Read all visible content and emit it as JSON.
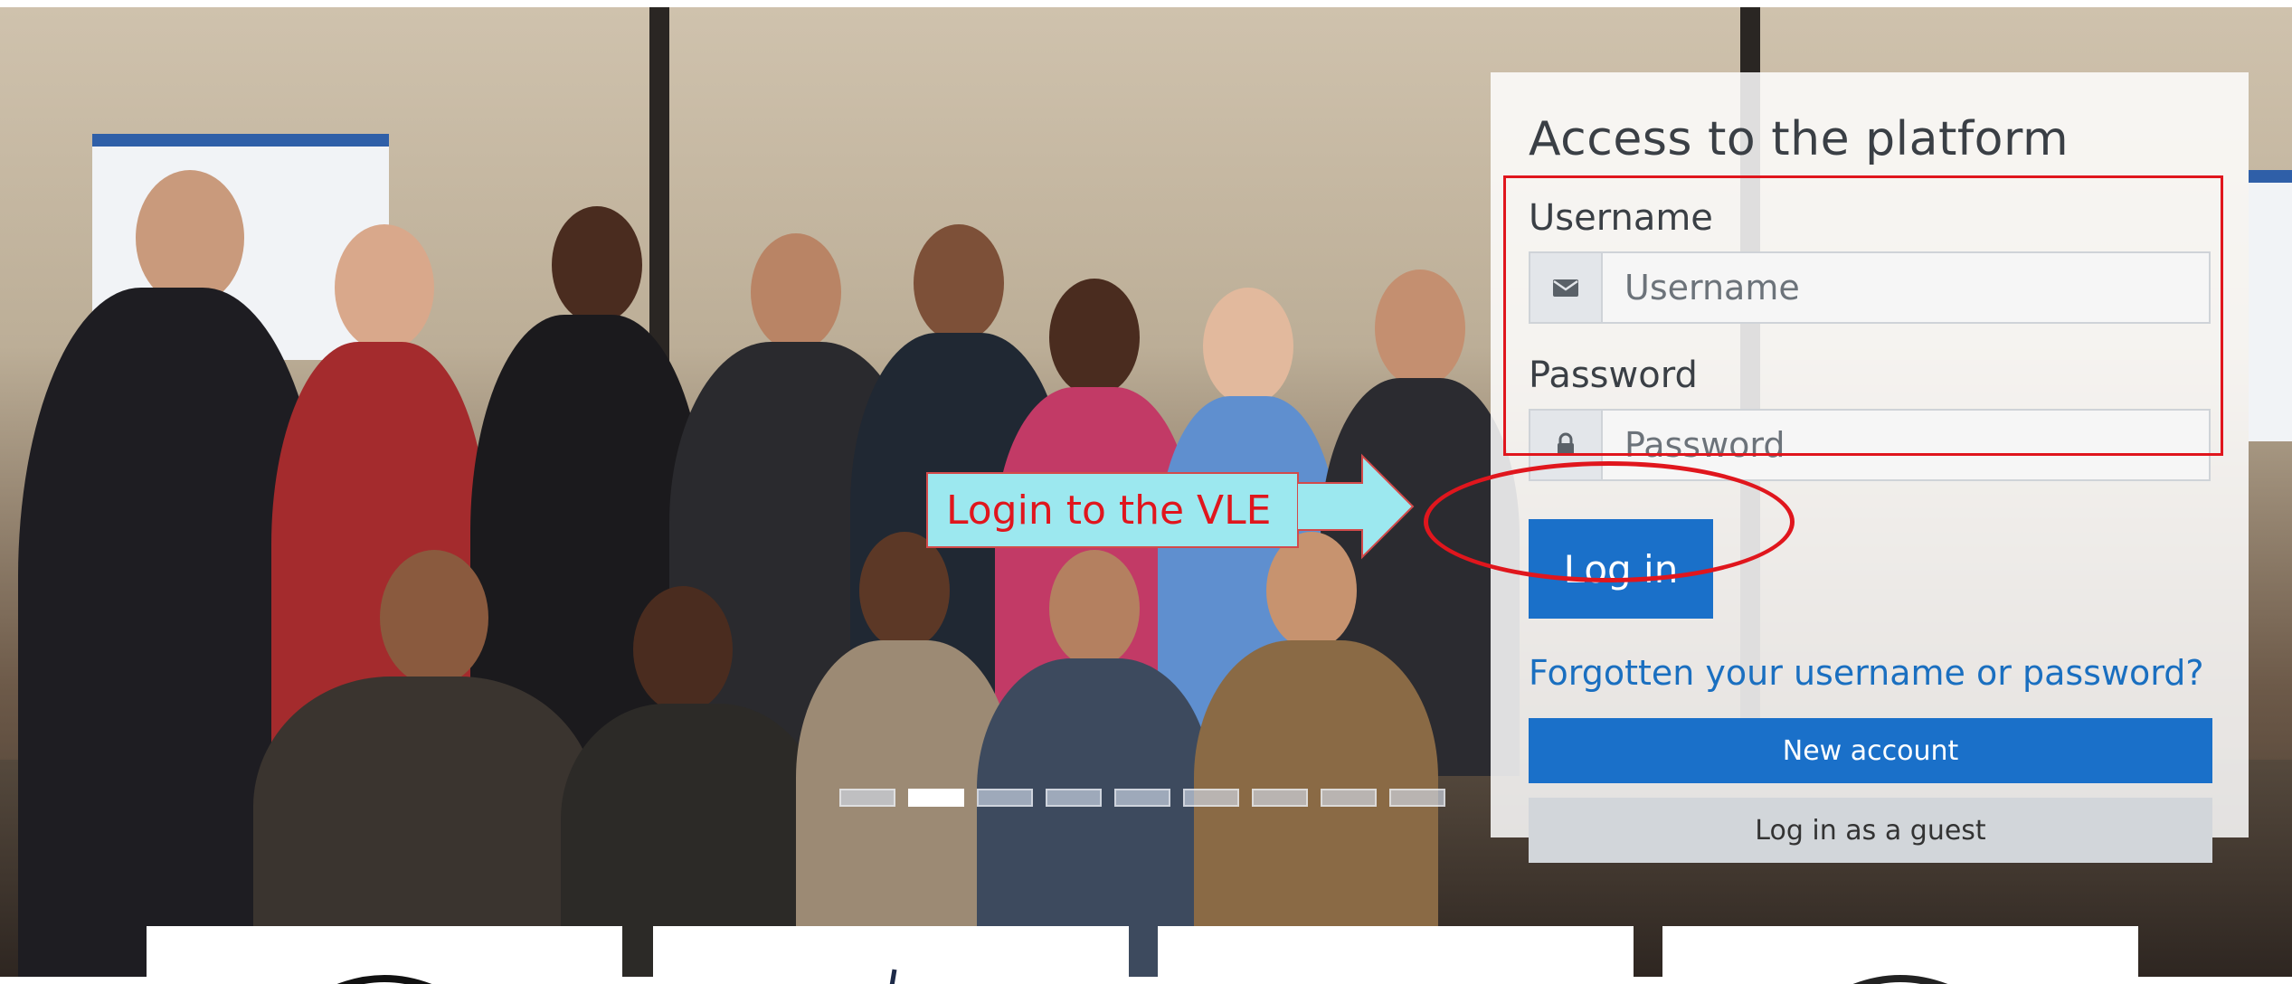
{
  "login": {
    "title": "Access to the platform",
    "username_label": "Username",
    "username_placeholder": "Username",
    "password_label": "Password",
    "password_placeholder": "Password",
    "login_button": "Log in",
    "forgot_link": "Forgotten your username or password?",
    "new_account_button": "New account",
    "guest_button": "Log in as a guest"
  },
  "annotation": {
    "callout_text": "Login to the VLE"
  },
  "carousel": {
    "slide_count": 9,
    "active_slide": 2
  },
  "icons": {
    "username": "envelope-icon",
    "password": "lock-icon"
  },
  "colors": {
    "primary": "#1a70c9",
    "annotation_red": "#e0161d",
    "callout_fill": "#9ce8ef"
  }
}
